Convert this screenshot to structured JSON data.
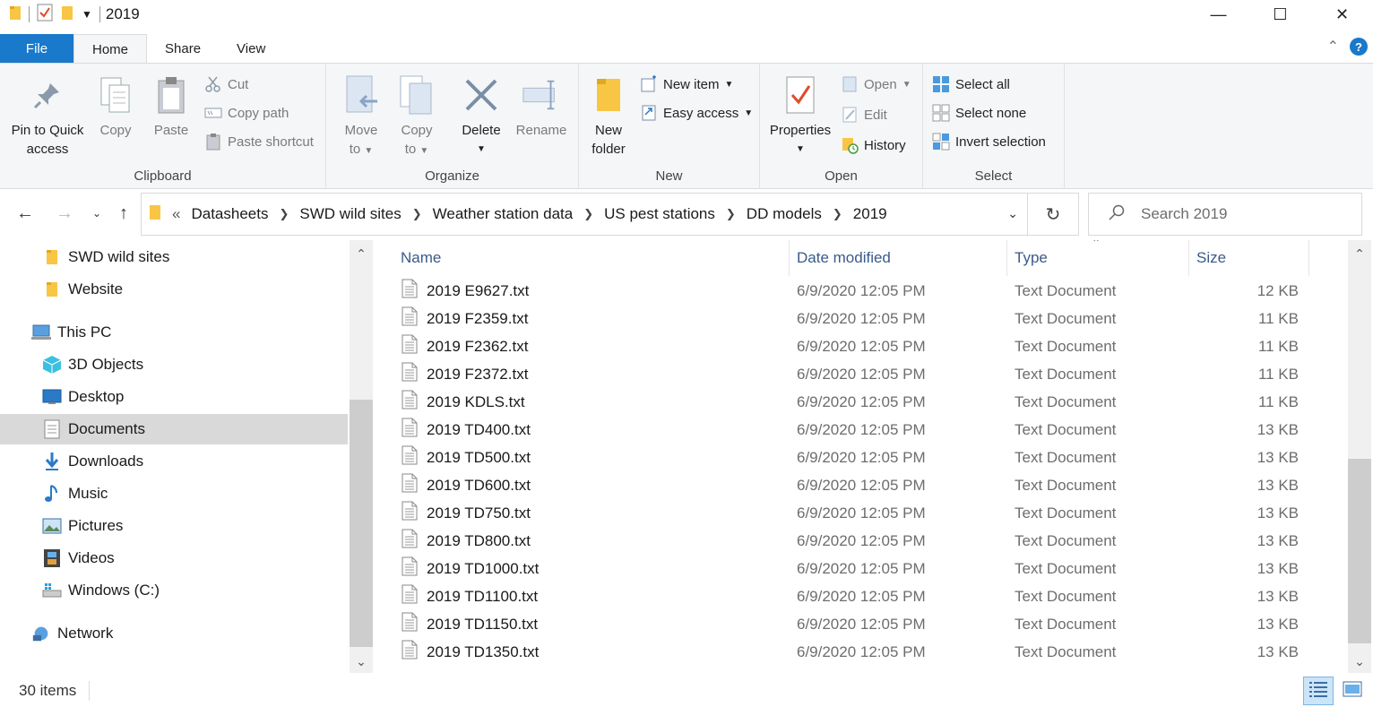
{
  "window": {
    "title": "2019",
    "minimize": "—",
    "maximize": "☐",
    "close": "✕"
  },
  "ribbon_tabs": [
    "File",
    "Home",
    "Share",
    "View"
  ],
  "ribbon": {
    "clipboard": {
      "label": "Clipboard",
      "pin": [
        "Pin to Quick",
        "access"
      ],
      "copy": "Copy",
      "paste": "Paste",
      "cut": "Cut",
      "copy_path": "Copy path",
      "paste_shortcut": "Paste shortcut"
    },
    "organize": {
      "label": "Organize",
      "move": [
        "Move",
        "to"
      ],
      "copy": [
        "Copy",
        "to"
      ],
      "delete": "Delete",
      "rename": "Rename"
    },
    "new": {
      "label": "New",
      "new_folder": [
        "New",
        "folder"
      ],
      "new_item": "New item",
      "easy_access": "Easy access"
    },
    "open": {
      "label": "Open",
      "properties": "Properties",
      "open": "Open",
      "edit": "Edit",
      "history": "History"
    },
    "select": {
      "label": "Select",
      "select_all": "Select all",
      "select_none": "Select none",
      "invert": "Invert selection"
    }
  },
  "address": {
    "overflow": "«",
    "crumbs": [
      "Datasheets",
      "SWD wild sites",
      "Weather station data",
      "US pest stations",
      "DD models",
      "2019"
    ]
  },
  "search": {
    "placeholder": "Search 2019"
  },
  "nav": [
    {
      "label": "SWD wild sites",
      "icon": "folder-icon",
      "indent": 1,
      "selected": false
    },
    {
      "label": "Website",
      "icon": "folder-icon",
      "indent": 1,
      "selected": false
    },
    {
      "label": "This PC",
      "icon": "computer-icon",
      "indent": 0,
      "selected": false
    },
    {
      "label": "3D Objects",
      "icon": "cube-icon",
      "indent": 1,
      "selected": false
    },
    {
      "label": "Desktop",
      "icon": "desktop-icon",
      "indent": 1,
      "selected": false
    },
    {
      "label": "Documents",
      "icon": "document-icon",
      "indent": 1,
      "selected": true
    },
    {
      "label": "Downloads",
      "icon": "download-icon",
      "indent": 1,
      "selected": false
    },
    {
      "label": "Music",
      "icon": "music-icon",
      "indent": 1,
      "selected": false
    },
    {
      "label": "Pictures",
      "icon": "picture-icon",
      "indent": 1,
      "selected": false
    },
    {
      "label": "Videos",
      "icon": "video-icon",
      "indent": 1,
      "selected": false
    },
    {
      "label": "Windows (C:)",
      "icon": "drive-icon",
      "indent": 1,
      "selected": false
    },
    {
      "label": "Network",
      "icon": "network-icon",
      "indent": 0,
      "selected": false
    }
  ],
  "columns": {
    "name": "Name",
    "date": "Date modified",
    "type": "Type",
    "size": "Size"
  },
  "files": [
    {
      "name": "2019 E9627.txt",
      "date": "6/9/2020 12:05 PM",
      "type": "Text Document",
      "size": "12 KB"
    },
    {
      "name": "2019 F2359.txt",
      "date": "6/9/2020 12:05 PM",
      "type": "Text Document",
      "size": "11 KB"
    },
    {
      "name": "2019 F2362.txt",
      "date": "6/9/2020 12:05 PM",
      "type": "Text Document",
      "size": "11 KB"
    },
    {
      "name": "2019 F2372.txt",
      "date": "6/9/2020 12:05 PM",
      "type": "Text Document",
      "size": "11 KB"
    },
    {
      "name": "2019 KDLS.txt",
      "date": "6/9/2020 12:05 PM",
      "type": "Text Document",
      "size": "11 KB"
    },
    {
      "name": "2019 TD400.txt",
      "date": "6/9/2020 12:05 PM",
      "type": "Text Document",
      "size": "13 KB"
    },
    {
      "name": "2019 TD500.txt",
      "date": "6/9/2020 12:05 PM",
      "type": "Text Document",
      "size": "13 KB"
    },
    {
      "name": "2019 TD600.txt",
      "date": "6/9/2020 12:05 PM",
      "type": "Text Document",
      "size": "13 KB"
    },
    {
      "name": "2019 TD750.txt",
      "date": "6/9/2020 12:05 PM",
      "type": "Text Document",
      "size": "13 KB"
    },
    {
      "name": "2019 TD800.txt",
      "date": "6/9/2020 12:05 PM",
      "type": "Text Document",
      "size": "13 KB"
    },
    {
      "name": "2019 TD1000.txt",
      "date": "6/9/2020 12:05 PM",
      "type": "Text Document",
      "size": "13 KB"
    },
    {
      "name": "2019 TD1100.txt",
      "date": "6/9/2020 12:05 PM",
      "type": "Text Document",
      "size": "13 KB"
    },
    {
      "name": "2019 TD1150.txt",
      "date": "6/9/2020 12:05 PM",
      "type": "Text Document",
      "size": "13 KB"
    },
    {
      "name": "2019 TD1350.txt",
      "date": "6/9/2020 12:05 PM",
      "type": "Text Document",
      "size": "13 KB"
    }
  ],
  "status": {
    "items": "30 items"
  },
  "colors": {
    "accent": "#1979ca",
    "folder": "#f8c644",
    "selected_nav": "#d9d9d9"
  }
}
